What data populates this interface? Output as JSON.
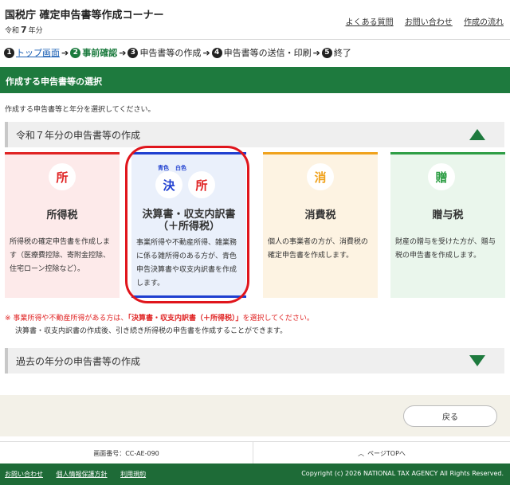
{
  "header": {
    "site_title": "国税庁 確定申告書等作成コーナー",
    "era_prefix": "令和",
    "era_year": "7",
    "era_suffix": "年分",
    "links": [
      "よくある質問",
      "お問い合わせ",
      "作成の流れ"
    ]
  },
  "steps": [
    {
      "num": "1",
      "label": "トップ画面"
    },
    {
      "num": "2",
      "label": "事前確認"
    },
    {
      "num": "3",
      "label": "申告書等の作成"
    },
    {
      "num": "4",
      "label": "申告書等の送信・印刷"
    },
    {
      "num": "5",
      "label": "終了"
    }
  ],
  "section_title": "作成する申告書等の選択",
  "instruction": "作成する申告書等と年分を選択してください。",
  "current_year_header": "令和７年分の申告書等の作成",
  "past_years_header": "過去の年分の申告書等の作成",
  "cards": {
    "shotoku": {
      "icon": "所",
      "name": "所得税",
      "desc": "所得税の確定申告書を作成します（医療費控除、寄附金控除、住宅ローン控除など）。"
    },
    "kessan": {
      "tag1": "青色",
      "tag2": "白色",
      "icon1": "決",
      "icon2": "所",
      "name_line1": "決算書・収支内訳書",
      "name_line2": "（＋所得税）",
      "desc": "事業所得や不動産所得、雑業務に係る雑所得のある方が、青色申告決算書や収支内訳書を作成します。"
    },
    "shohi": {
      "icon": "消",
      "name": "消費税",
      "desc": "個人の事業者の方が、消費税の確定申告書を作成します。"
    },
    "zoyo": {
      "icon": "贈",
      "name": "贈与税",
      "desc": "財産の贈与を受けた方が、贈与税の申告書を作成します。"
    }
  },
  "notes": {
    "mark": "※",
    "line1_before": "事業所得や不動産所得がある方は、",
    "line1_highlight": "「決算書・収支内訳書（＋所得税）」",
    "line1_after": "を選択してください。",
    "line2": "決算書・収支内訳書の作成後、引き続き所得税の申告書を作成することができます。"
  },
  "back_button": "戻る",
  "footer": {
    "screen_id": "画面番号：CC-AE-090",
    "page_top": "ページTOPへ",
    "links": [
      "お問い合わせ",
      "個人情報保護方針",
      "利用規約"
    ],
    "copyright": "Copyright (c) 2026 NATIONAL TAX AGENCY All Rights Reserved."
  }
}
